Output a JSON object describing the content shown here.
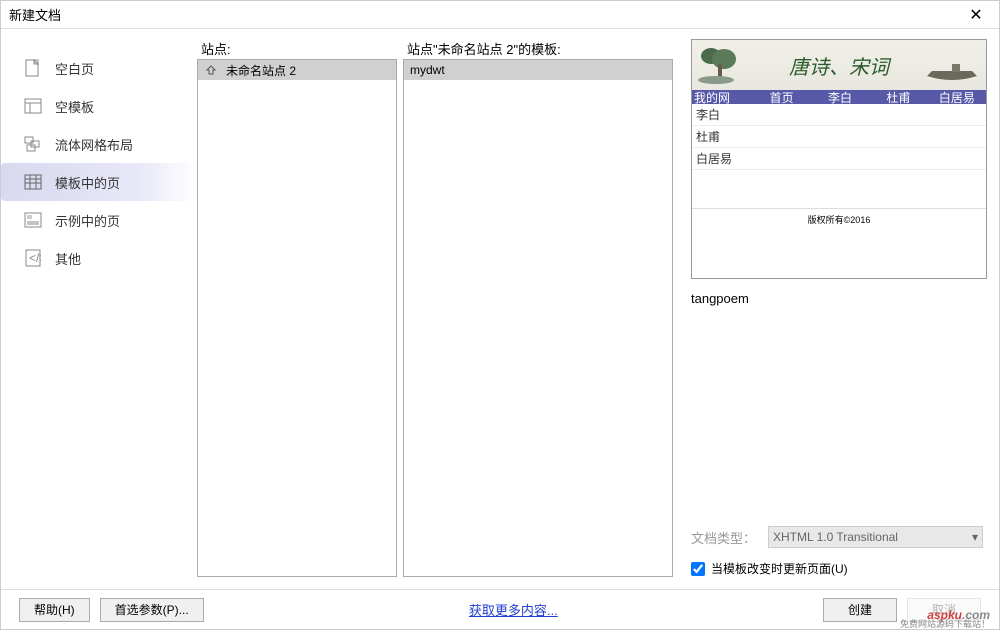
{
  "title": "新建文档",
  "sidebar": {
    "items": [
      {
        "label": "空白页"
      },
      {
        "label": "空模板"
      },
      {
        "label": "流体网格布局"
      },
      {
        "label": "模板中的页"
      },
      {
        "label": "示例中的页"
      },
      {
        "label": "其他"
      }
    ]
  },
  "columns": {
    "sites_label": "站点:",
    "templates_label": "站点\"未命名站点 2\"的模板:",
    "site_item": "未命名站点 2",
    "template_item": "mydwt"
  },
  "preview": {
    "banner_title": "唐诗、宋词",
    "nav_welcome": "欢迎来到我的网站！",
    "nav_items": [
      "首页",
      "李白",
      "杜甫",
      "白居易"
    ],
    "list_items": [
      "李白",
      "杜甫",
      "白居易"
    ],
    "footer_text": "版权所有©2016",
    "name": "tangpoem"
  },
  "doc_type": {
    "label": "文档类型：",
    "value": "XHTML 1.0 Transitional"
  },
  "checkbox": {
    "label": "当模板改变时更新页面(U)"
  },
  "footer": {
    "help": "帮助(H)",
    "prefs": "首选参数(P)...",
    "more": "获取更多内容...",
    "create": "创建",
    "cancel": "取消"
  },
  "watermark": "aspku",
  "watermark_sub": "免费网站源码下载站！"
}
